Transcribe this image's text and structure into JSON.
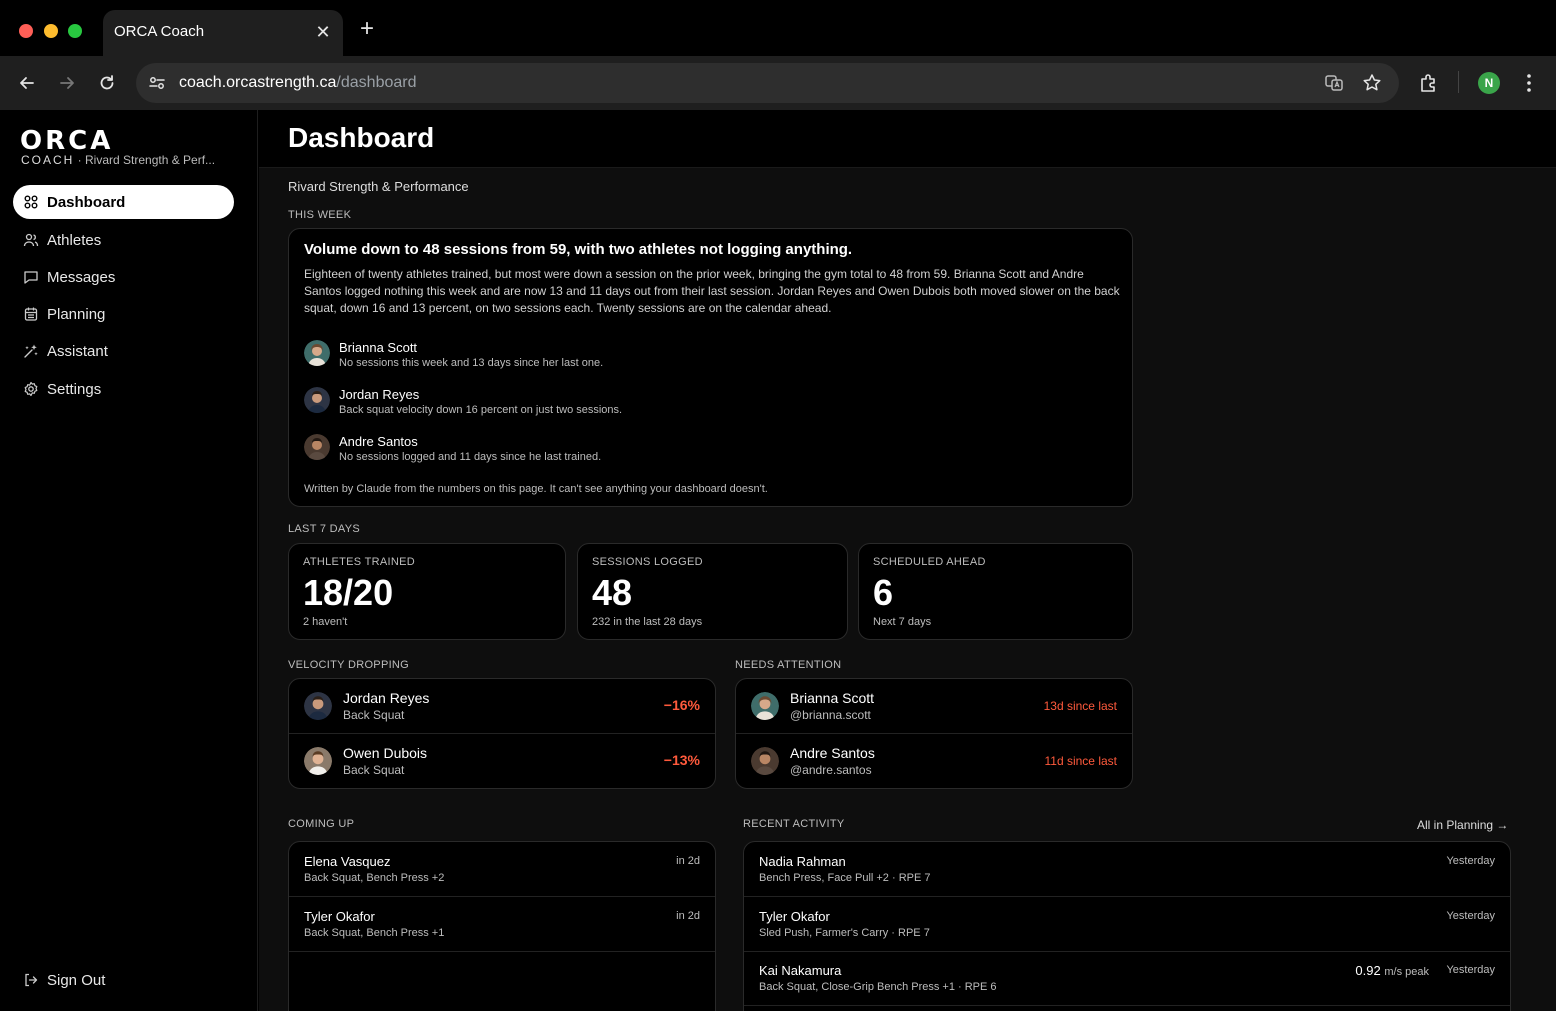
{
  "browser": {
    "tab_title": "ORCA Coach",
    "tab_close": "✕",
    "new_tab": "+",
    "url_host": "coach.orcastrength.ca",
    "url_path": "/dashboard",
    "profile_initial": "N"
  },
  "sidebar": {
    "logo": "ORCA",
    "logo_coach": "COACH",
    "logo_org": " · Rivard Strength & Perf...",
    "items": [
      {
        "label": "Dashboard",
        "icon": "grid-icon"
      },
      {
        "label": "Athletes",
        "icon": "users-icon"
      },
      {
        "label": "Messages",
        "icon": "message-icon"
      },
      {
        "label": "Planning",
        "icon": "calendar-icon"
      },
      {
        "label": "Assistant",
        "icon": "sparkle-icon"
      },
      {
        "label": "Settings",
        "icon": "gear-icon"
      }
    ],
    "sign_out": "Sign Out"
  },
  "page": {
    "title": "Dashboard",
    "org": "Rivard Strength & Performance"
  },
  "this_week": {
    "label": "THIS WEEK",
    "headline": "Volume down to 48 sessions from 59, with two athletes not logging anything.",
    "body": "Eighteen of twenty athletes trained, but most were down a session on the prior week, bringing the gym total to 48 from 59. Brianna Scott and Andre Santos logged nothing this week and are now 13 and 11 days out from their last session. Jordan Reyes and Owen Dubois both moved slower on the back squat, down 16 and 13 percent, on two sessions each. Twenty sessions are on the calendar ahead.",
    "callouts": [
      {
        "name": "Brianna Scott",
        "note": "No sessions this week and 13 days since her last one."
      },
      {
        "name": "Jordan Reyes",
        "note": "Back squat velocity down 16 percent on just two sessions."
      },
      {
        "name": "Andre Santos",
        "note": "No sessions logged and 11 days since he last trained."
      }
    ],
    "footer": "Written by Claude from the numbers on this page. It can't see anything your dashboard doesn't."
  },
  "last7": {
    "label": "LAST 7 DAYS",
    "kpis": [
      {
        "label": "ATHLETES TRAINED",
        "value": "18/20",
        "sub": "2 haven't"
      },
      {
        "label": "SESSIONS LOGGED",
        "value": "48",
        "sub": "232 in the last 28 days"
      },
      {
        "label": "SCHEDULED AHEAD",
        "value": "6",
        "sub": "Next 7 days"
      }
    ]
  },
  "velocity": {
    "label": "VELOCITY DROPPING",
    "rows": [
      {
        "name": "Jordan Reyes",
        "lift": "Back Squat",
        "change": "−16%"
      },
      {
        "name": "Owen Dubois",
        "lift": "Back Squat",
        "change": "−13%"
      }
    ]
  },
  "attention": {
    "label": "NEEDS ATTENTION",
    "rows": [
      {
        "name": "Brianna Scott",
        "handle": "@brianna.scott",
        "since": "13d since last"
      },
      {
        "name": "Andre Santos",
        "handle": "@andre.santos",
        "since": "11d since last"
      }
    ]
  },
  "coming_up": {
    "label": "COMING UP",
    "rows": [
      {
        "name": "Elena Vasquez",
        "detail": "Back Squat, Bench Press +2",
        "when": "in 2d"
      },
      {
        "name": "Tyler Okafor",
        "detail": "Back Squat, Bench Press +1",
        "when": "in 2d"
      }
    ]
  },
  "recent": {
    "label": "RECENT ACTIVITY",
    "link": "All in Planning →",
    "rows": [
      {
        "name": "Nadia Rahman",
        "detail": "Bench Press, Face Pull +2 · RPE 7",
        "when": "Yesterday",
        "metric": "",
        "metric_unit": ""
      },
      {
        "name": "Tyler Okafor",
        "detail": "Sled Push, Farmer's Carry · RPE 7",
        "when": "Yesterday",
        "metric": "",
        "metric_unit": ""
      },
      {
        "name": "Kai Nakamura",
        "detail": "Back Squat, Close-Grip Bench Press +1 · RPE 6",
        "when": "Yesterday",
        "metric": "0.92",
        "metric_unit": "m/s peak"
      }
    ]
  },
  "colors": {
    "accent_alert": "#ff5a3c",
    "active_nav_bg": "#ffffff"
  }
}
